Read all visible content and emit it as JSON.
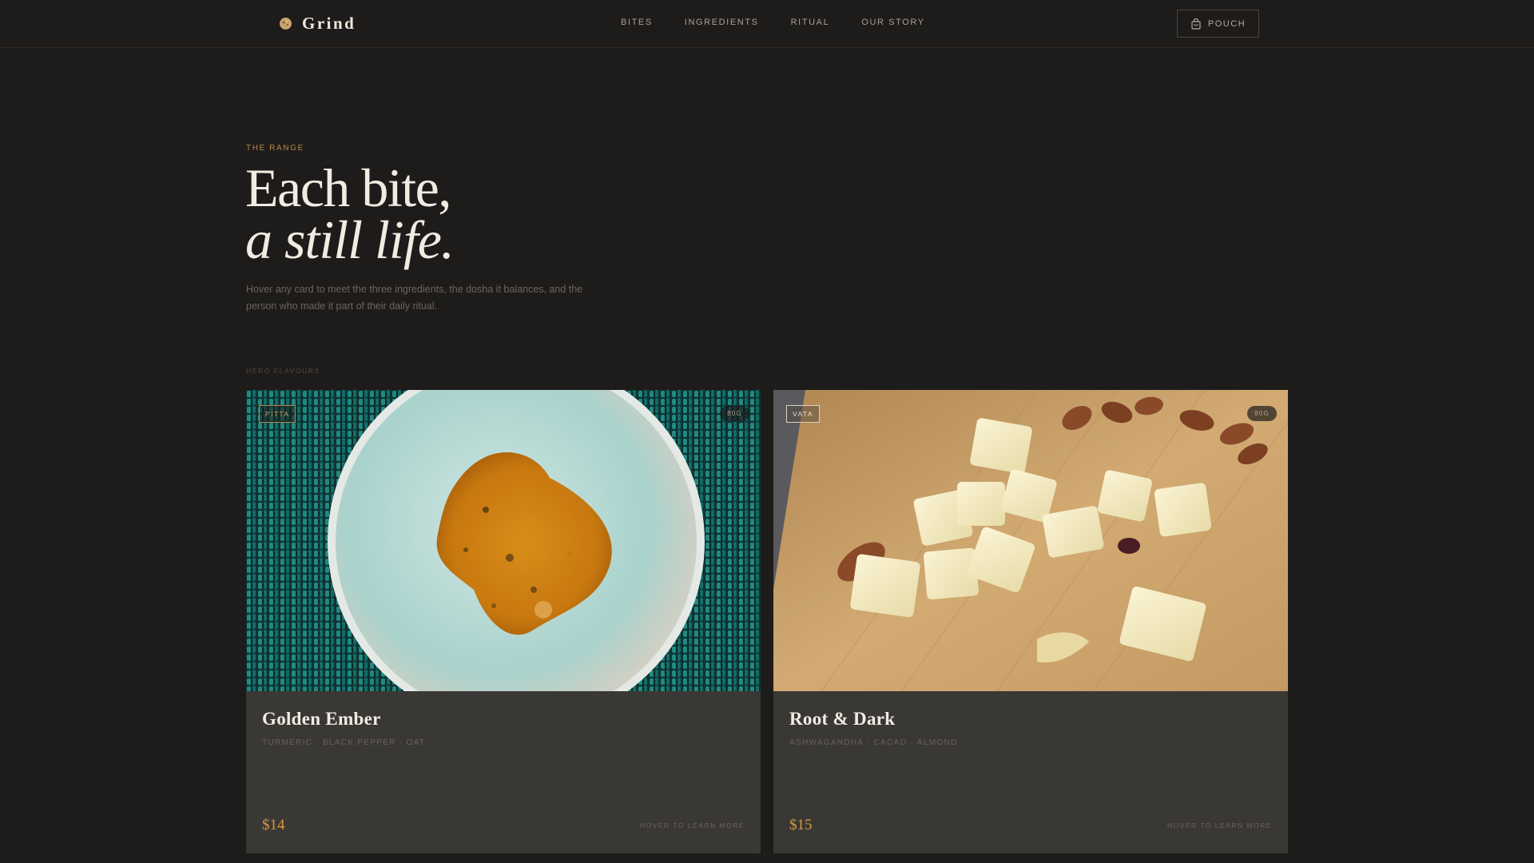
{
  "brand": {
    "name": "Grind",
    "icon": "spice-ball-icon"
  },
  "nav": {
    "links": [
      "BITES",
      "INGREDIENTS",
      "RITUAL",
      "OUR STORY"
    ],
    "pouch_label": "POUCH",
    "pouch_icon": "bag-icon"
  },
  "hero": {
    "eyebrow": "THE RANGE",
    "headline_line1": "Each bite,",
    "headline_line2": "a still life.",
    "lede": "Hover any card to meet the three ingredients, the dosha it balances, and the person who made it part of their daily ritual."
  },
  "section_label": "HERO FLAVOURS",
  "cards": [
    {
      "dosha": "PITTA",
      "weight": "80G",
      "title": "Golden Ember",
      "ingredients": "TURMERIC · BLACK PEPPER · OAT",
      "price": "$14",
      "hint": "HOVER TO LEARN MORE",
      "image": "turmeric-bowl-photo"
    },
    {
      "dosha": "VATA",
      "weight": "80G",
      "title": "Root & Dark",
      "ingredients": "ASHWAGANDHA · CACAO · ALMOND",
      "price": "$15",
      "hint": "HOVER TO LEARN MORE",
      "image": "white-chocolate-almond-photo"
    }
  ],
  "colors": {
    "background": "#1e1c1a",
    "card": "#3a3835",
    "accent_gold": "#d79a3a",
    "eyebrow": "#b08a55"
  }
}
